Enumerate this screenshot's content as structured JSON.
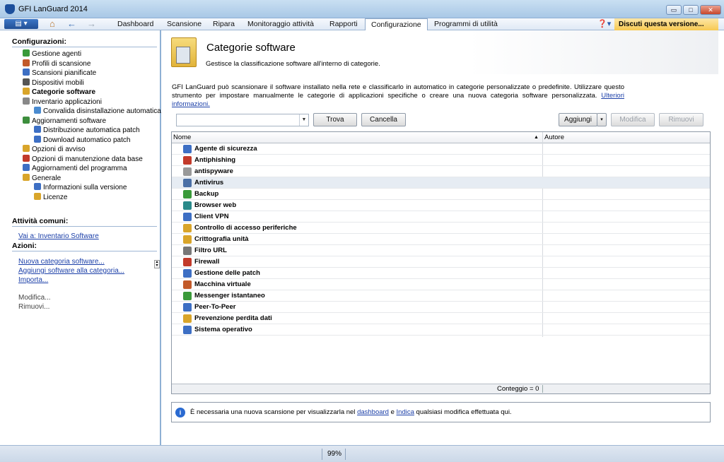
{
  "window": {
    "title": "GFI LanGuard 2014",
    "min": "▭",
    "max": "□",
    "close": "✕"
  },
  "menubar": {
    "app_menu_label": "▤ ▾",
    "back": "←",
    "forward": "→",
    "tabs": [
      "Dashboard",
      "Scansione",
      "Ripara",
      "Monitoraggio attività",
      "Rapporti",
      "Configurazione",
      "Programmi di utilità"
    ],
    "active_tab": "Configurazione",
    "help": "❓▾",
    "discuss": "Discuti questa versione..."
  },
  "sidebar": {
    "config_heading": "Configurazioni:",
    "tree": [
      {
        "label": "Gestione agenti",
        "color": "#3a9a3a"
      },
      {
        "label": "Profili di scansione",
        "color": "#c25a2a"
      },
      {
        "label": "Scansioni pianificate",
        "color": "#3d6fc4"
      },
      {
        "label": "Dispositivi mobili",
        "color": "#555"
      },
      {
        "label": "Categorie software",
        "color": "#d9a52a"
      },
      {
        "label": "Inventario applicazioni",
        "color": "#888"
      },
      {
        "label": "Convalida disinstallazione automatica",
        "color": "#4a8bd0"
      },
      {
        "label": "Aggiornamenti software",
        "color": "#3d8e3d"
      },
      {
        "label": "Distribuzione automatica patch",
        "color": "#3d6fc4"
      },
      {
        "label": "Download automatico patch",
        "color": "#3d6fc4"
      },
      {
        "label": "Opzioni di avviso",
        "color": "#d9a52a"
      },
      {
        "label": "Opzioni di manutenzione data base",
        "color": "#c23a2a"
      },
      {
        "label": "Aggiornamenti del programma",
        "color": "#3d6fc4"
      },
      {
        "label": "Generale",
        "color": "#d9a52a"
      },
      {
        "label": "Informazioni sulla versione",
        "color": "#3d6fc4"
      },
      {
        "label": "Licenze",
        "color": "#d9a52a"
      }
    ],
    "common_heading": "Attività comuni:",
    "common_link": "Vai a: Inventario Software",
    "actions_heading": "Azioni:",
    "actions": [
      "Nuova categoria software...",
      "Aggiungi software alla categoria...",
      "Importa..."
    ],
    "disabled_actions": [
      "Modifica...",
      "Rimuovi..."
    ]
  },
  "page": {
    "title": "Categorie software",
    "subtitle": "Gestisce la classificazione software all'interno di categorie.",
    "description": "GFI LanGuard può scansionare il software installato nella rete e classificarlo in automatico in categorie personalizzate o predefinite. Utilizzare questo strumento per impostare manualmente le categorie di applicazioni specifiche o creare una nuova categoria software personalizzata.",
    "more_info": "Ulteriori informazioni."
  },
  "toolbar": {
    "search_value": "",
    "find": "Trova",
    "cancel": "Cancella",
    "add": "Aggiungi",
    "add_arrow": "▾",
    "edit": "Modifica",
    "remove": "Rimuovi"
  },
  "grid": {
    "col_name": "Nome",
    "col_author": "Autore",
    "sort_arrow": "▲",
    "rows": [
      {
        "name": "Agente di sicurezza",
        "color": "#3d6fc4"
      },
      {
        "name": "Antiphishing",
        "color": "#c23a2a"
      },
      {
        "name": "antispyware",
        "color": "#999"
      },
      {
        "name": "Antivirus",
        "color": "#4a6fa5"
      },
      {
        "name": "Backup",
        "color": "#3a9a3a"
      },
      {
        "name": "Browser web",
        "color": "#2a8a8a"
      },
      {
        "name": "Client VPN",
        "color": "#3d6fc4"
      },
      {
        "name": "Controllo di accesso periferiche",
        "color": "#d9a52a"
      },
      {
        "name": "Crittografia unità",
        "color": "#d9a52a"
      },
      {
        "name": "Filtro URL",
        "color": "#777"
      },
      {
        "name": "Firewall",
        "color": "#c23a2a"
      },
      {
        "name": "Gestione delle patch",
        "color": "#3d6fc4"
      },
      {
        "name": "Macchina virtuale",
        "color": "#c25a2a"
      },
      {
        "name": "Messenger istantaneo",
        "color": "#3a9a3a"
      },
      {
        "name": "Peer-To-Peer",
        "color": "#3d6fc4"
      },
      {
        "name": "Prevenzione perdita dati",
        "color": "#d9a52a"
      },
      {
        "name": "Sistema operativo",
        "color": "#3d6fc4"
      }
    ],
    "selected_index": 3,
    "count": "Conteggio = 0"
  },
  "notice": {
    "icon": "i",
    "text1": "È necessaria una nuova scansione per visualizzarla nel",
    "link1": "dashboard",
    "text2": "e",
    "link2": "Indica",
    "text3": "qualsiasi modifica effettuata qui."
  },
  "status": {
    "zoom": "99%"
  }
}
